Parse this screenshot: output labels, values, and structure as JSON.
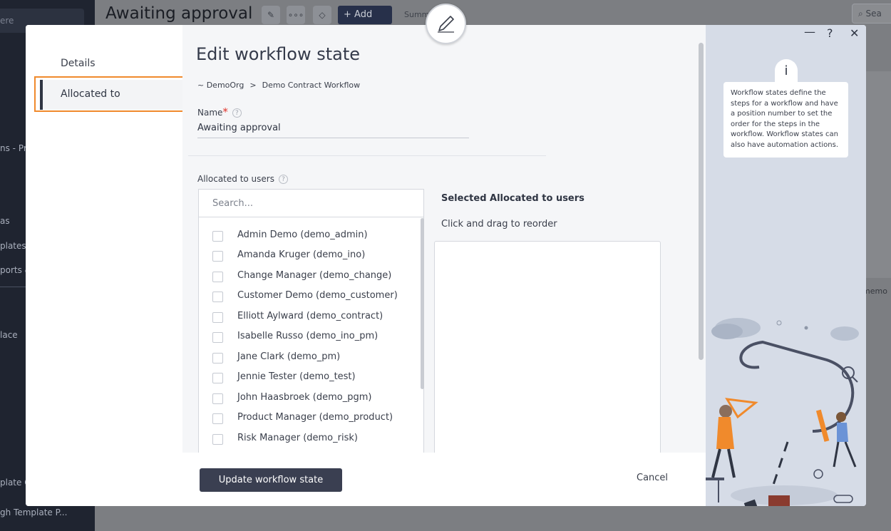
{
  "background": {
    "sidebar": {
      "search_text": "ere",
      "items": [
        "ns - Pro",
        "as",
        "plates",
        "ports &",
        "lace",
        "plate C",
        "gh Template P..."
      ]
    },
    "page_title": "Awaiting approval",
    "add_label": "+ Add",
    "summary_label": "Summa",
    "search_label": "Sea",
    "memo_label": "memo"
  },
  "modal": {
    "nav": {
      "details": "Details",
      "allocated_to": "Allocated to"
    },
    "title": "Edit workflow state",
    "breadcrumb": {
      "org": "~ DemoOrg",
      "separator": ">",
      "workflow": "Demo Contract Workflow"
    },
    "name_field": {
      "label": "Name",
      "required_mark": "*",
      "help": "?",
      "value": "Awaiting approval"
    },
    "allocated_users": {
      "label": "Allocated to users",
      "help": "?",
      "search_placeholder": "Search...",
      "users": [
        "Admin Demo (demo_admin)",
        "Amanda Kruger (demo_ino)",
        "Change Manager (demo_change)",
        "Customer Demo (demo_customer)",
        "Elliott Aylward (demo_contract)",
        "Isabelle Russo (demo_ino_pm)",
        "Jane Clark (demo_pm)",
        "Jennie Tester (demo_test)",
        "John Haasbroek (demo_pgm)",
        "Product Manager (demo_product)",
        "Risk Manager (demo_risk)"
      ]
    },
    "selected_users": {
      "title": "Selected Allocated to users",
      "hint": "Click and drag to reorder"
    },
    "footer": {
      "update_label": "Update workflow state",
      "cancel_label": "Cancel"
    },
    "info_panel": {
      "minimize": "—",
      "help": "?",
      "close": "✕",
      "icon_text": "i",
      "text": "Workflow states define the steps for a workflow and have a position number to set the order for the steps in the workflow. Workflow states can also have automation actions."
    }
  },
  "colors": {
    "highlight": "#f08a2c",
    "primary_button": "#3a3f51",
    "required": "#e0342b",
    "info_panel_bg": "#d6dce7"
  }
}
